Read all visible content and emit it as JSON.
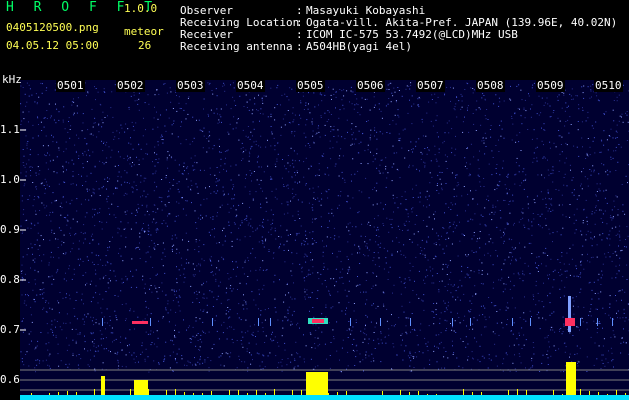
{
  "app": {
    "title": "H R O F F T",
    "version": "1.0.0",
    "filename": "0405120500.png",
    "datetime": "04.05.12 05:00",
    "meteor_label": "meteor",
    "meteor_count": "26"
  },
  "info": [
    {
      "key": "Observer",
      "value": "Masayuki Kobayashi"
    },
    {
      "key": "Receiving Location",
      "value": "Ogata-vill. Akita-Pref. JAPAN (139.96E, 40.02N)"
    },
    {
      "key": "Receiver",
      "value": "ICOM IC-575 53.7492(@LCD)MHz USB"
    },
    {
      "key": "Receiving antenna",
      "value": "A504HB(yagi 4el)"
    }
  ],
  "colors": {
    "background": "#000000",
    "spectrogram_base": "#000030",
    "noise": "#3040c0",
    "echo": "#ff3060",
    "count_bars": "#ffff00",
    "baseline": "#00e0ff",
    "guide_lines": "#808080"
  },
  "spectrogram": {
    "y_unit": "kHz",
    "y_ticks": [
      "1.1",
      "1.0",
      "0.9",
      "0.8",
      "0.7",
      "0.6"
    ],
    "time_labels": [
      "0501",
      "0502",
      "0503",
      "0504",
      "0505",
      "0506",
      "0507",
      "0508",
      "0509",
      "0510"
    ]
  }
}
